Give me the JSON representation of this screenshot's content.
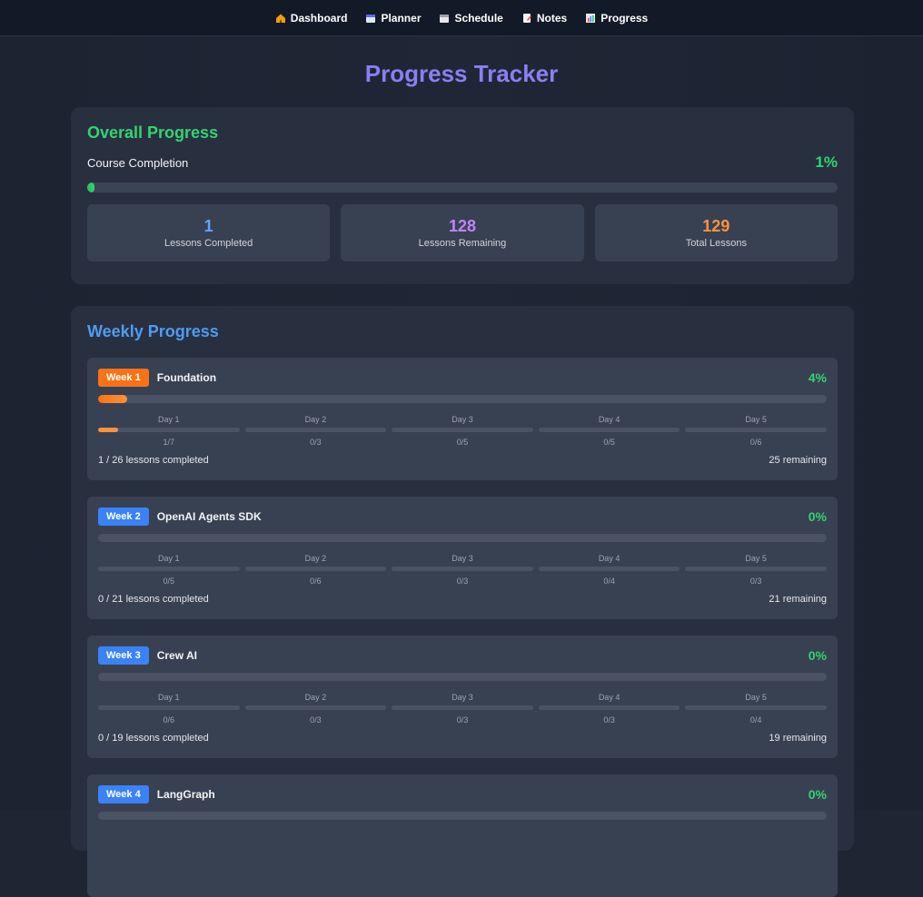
{
  "nav": [
    {
      "label": "Dashboard",
      "icon": "house-icon"
    },
    {
      "label": "Planner",
      "icon": "calendar-icon"
    },
    {
      "label": "Schedule",
      "icon": "spiral-calendar-icon"
    },
    {
      "label": "Notes",
      "icon": "memo-icon"
    },
    {
      "label": "Progress",
      "icon": "bar-chart-icon"
    }
  ],
  "page_title": "Progress Tracker",
  "overall": {
    "title": "Overall Progress",
    "completion_label": "Course Completion",
    "completion_pct": "1%",
    "completion_fraction": 0.01,
    "stats": [
      {
        "value": "1",
        "label": "Lessons Completed",
        "color": "#60a5fa"
      },
      {
        "value": "128",
        "label": "Lessons Remaining",
        "color": "#c084fc"
      },
      {
        "value": "129",
        "label": "Total Lessons",
        "color": "#fb923c"
      }
    ]
  },
  "weekly": {
    "title": "Weekly Progress",
    "weeks": [
      {
        "badge": "Week 1",
        "badge_color": "#f97316",
        "name": "Foundation",
        "pct": "4%",
        "fraction": 0.04,
        "days": [
          {
            "label": "Day 1",
            "count": "1/7",
            "fraction": 0.14
          },
          {
            "label": "Day 2",
            "count": "0/3",
            "fraction": 0
          },
          {
            "label": "Day 3",
            "count": "0/5",
            "fraction": 0
          },
          {
            "label": "Day 4",
            "count": "0/5",
            "fraction": 0
          },
          {
            "label": "Day 5",
            "count": "0/6",
            "fraction": 0
          }
        ],
        "completed": "1 / 26 lessons completed",
        "remaining": "25 remaining"
      },
      {
        "badge": "Week 2",
        "badge_color": "#3b82f6",
        "name": "OpenAI Agents SDK",
        "pct": "0%",
        "fraction": 0,
        "days": [
          {
            "label": "Day 1",
            "count": "0/5",
            "fraction": 0
          },
          {
            "label": "Day 2",
            "count": "0/6",
            "fraction": 0
          },
          {
            "label": "Day 3",
            "count": "0/3",
            "fraction": 0
          },
          {
            "label": "Day 4",
            "count": "0/4",
            "fraction": 0
          },
          {
            "label": "Day 5",
            "count": "0/3",
            "fraction": 0
          }
        ],
        "completed": "0 / 21 lessons completed",
        "remaining": "21 remaining"
      },
      {
        "badge": "Week 3",
        "badge_color": "#3b82f6",
        "name": "Crew AI",
        "pct": "0%",
        "fraction": 0,
        "days": [
          {
            "label": "Day 1",
            "count": "0/6",
            "fraction": 0
          },
          {
            "label": "Day 2",
            "count": "0/3",
            "fraction": 0
          },
          {
            "label": "Day 3",
            "count": "0/3",
            "fraction": 0
          },
          {
            "label": "Day 4",
            "count": "0/3",
            "fraction": 0
          },
          {
            "label": "Day 5",
            "count": "0/4",
            "fraction": 0
          }
        ],
        "completed": "0 / 19 lessons completed",
        "remaining": "19 remaining"
      },
      {
        "badge": "Week 4",
        "badge_color": "#3b82f6",
        "name": "LangGraph",
        "pct": "0%",
        "fraction": 0,
        "days": [],
        "completed": "",
        "remaining": ""
      }
    ]
  }
}
